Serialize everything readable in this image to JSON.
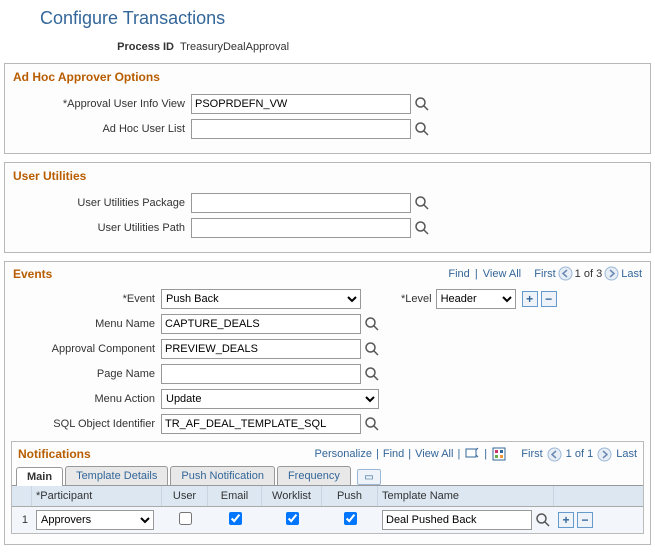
{
  "page": {
    "title": "Configure Transactions"
  },
  "header": {
    "process_id_label": "Process ID",
    "process_id_value": "TreasuryDealApproval"
  },
  "adhoc": {
    "title": "Ad Hoc Approver Options",
    "user_info_view_label": "*Approval User Info View",
    "user_info_view_value": "PSOPRDEFN_VW",
    "user_list_label": "Ad Hoc User List",
    "user_list_value": ""
  },
  "utilities": {
    "title": "User Utilities",
    "package_label": "User Utilities Package",
    "package_value": "",
    "path_label": "User Utilities Path",
    "path_value": ""
  },
  "events": {
    "title": "Events",
    "nav": {
      "find": "Find",
      "view_all": "View All",
      "first": "First",
      "count": "1 of 3",
      "last": "Last"
    },
    "event_label": "*Event",
    "event_value": "Push Back",
    "level_label": "*Level",
    "level_value": "Header",
    "menu_name_label": "Menu Name",
    "menu_name_value": "CAPTURE_DEALS",
    "component_label": "Approval Component",
    "component_value": "PREVIEW_DEALS",
    "page_name_label": "Page Name",
    "page_name_value": "",
    "menu_action_label": "Menu Action",
    "menu_action_value": "Update",
    "sql_obj_label": "SQL Object Identifier",
    "sql_obj_value": "TR_AF_DEAL_TEMPLATE_SQL"
  },
  "notifications": {
    "title": "Notifications",
    "links": {
      "personalize": "Personalize",
      "find": "Find",
      "view_all": "View All",
      "first": "First",
      "count": "1 of 1",
      "last": "Last"
    },
    "tabs": [
      "Main",
      "Template Details",
      "Push Notification",
      "Frequency"
    ],
    "active_tab": 0,
    "grid": {
      "headers": {
        "participant": "*Participant",
        "user": "User",
        "email": "Email",
        "worklist": "Worklist",
        "push": "Push",
        "template_name": "Template Name"
      },
      "rows": [
        {
          "num": "1",
          "participant": "Approvers",
          "user": false,
          "email": true,
          "worklist": true,
          "push": true,
          "template_name": "Deal Pushed Back"
        }
      ]
    }
  }
}
